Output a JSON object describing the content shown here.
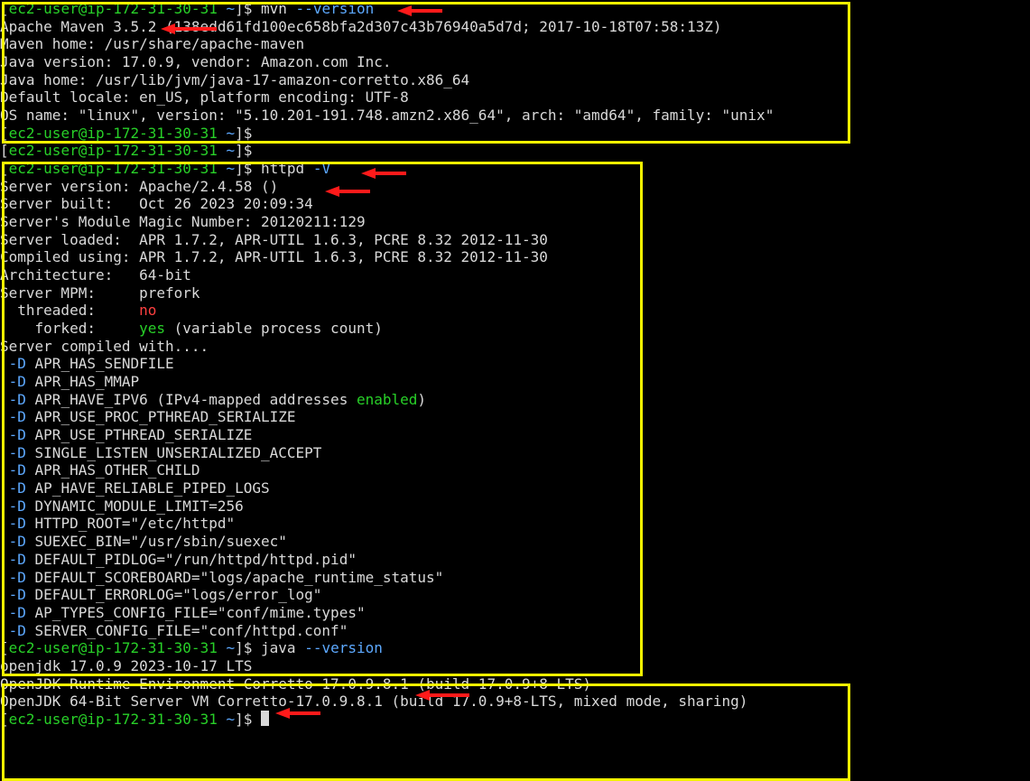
{
  "prompt": {
    "user": "ec2-user",
    "host": "ip-172-31-30-31",
    "cwd": "~"
  },
  "block1": {
    "cmd": "mvn",
    "opt": "--version",
    "out": [
      "Apache Maven 3.5.2 (138edd61fd100ec658bfa2d307c43b76940a5d7d; 2017-10-18T07:58:13Z)",
      "Maven home: /usr/share/apache-maven",
      "Java version: 17.0.9, vendor: Amazon.com Inc.",
      "Java home: /usr/lib/jvm/java-17-amazon-corretto.x86_64",
      "Default locale: en_US, platform encoding: UTF-8",
      "OS name: \"linux\", version: \"5.10.201-191.748.amzn2.x86_64\", arch: \"amd64\", family: \"unix\""
    ]
  },
  "gap_prompts": 2,
  "block2": {
    "cmd": "httpd",
    "opt": "-V",
    "header": [
      "Server version: Apache/2.4.58 ()",
      "Server built:   Oct 26 2023 20:09:34",
      "Server's Module Magic Number: 20120211:129",
      "Server loaded:  APR 1.7.2, APR-UTIL 1.6.3, PCRE 8.32 2012-11-30",
      "Compiled using: APR 1.7.2, APR-UTIL 1.6.3, PCRE 8.32 2012-11-30",
      "Architecture:   64-bit",
      "Server MPM:     prefork"
    ],
    "mpm_threaded_label": "  threaded:",
    "mpm_threaded_val": "no",
    "mpm_forked_label": "    forked:",
    "mpm_forked_val": "yes",
    "mpm_forked_suffix": " (variable process count)",
    "compiled_label": "Server compiled with....",
    "flags": [
      "APR_HAS_SENDFILE",
      "APR_HAS_MMAP",
      "APR_HAVE_IPV6 (IPv4-mapped addresses enabled)",
      "APR_USE_PROC_PTHREAD_SERIALIZE",
      "APR_USE_PTHREAD_SERIALIZE",
      "SINGLE_LISTEN_UNSERIALIZED_ACCEPT",
      "APR_HAS_OTHER_CHILD",
      "AP_HAVE_RELIABLE_PIPED_LOGS",
      "DYNAMIC_MODULE_LIMIT=256",
      "HTTPD_ROOT=\"/etc/httpd\"",
      "SUEXEC_BIN=\"/usr/sbin/suexec\"",
      "DEFAULT_PIDLOG=\"/run/httpd/httpd.pid\"",
      "DEFAULT_SCOREBOARD=\"logs/apache_runtime_status\"",
      "DEFAULT_ERRORLOG=\"logs/error_log\"",
      "AP_TYPES_CONFIG_FILE=\"conf/mime.types\"",
      "SERVER_CONFIG_FILE=\"conf/httpd.conf\""
    ],
    "flag_ipv6_index": 2,
    "flag_enabled_word": "enabled"
  },
  "block3": {
    "cmd": "java",
    "opt": "--version",
    "out": [
      "openjdk 17.0.9 2023-10-17 LTS",
      "OpenJDK Runtime Environment Corretto-17.0.9.8.1 (build 17.0.9+8-LTS)",
      "OpenJDK 64-Bit Server VM Corretto-17.0.9.8.1 (build 17.0.9+8-LTS, mixed mode, sharing)"
    ]
  }
}
